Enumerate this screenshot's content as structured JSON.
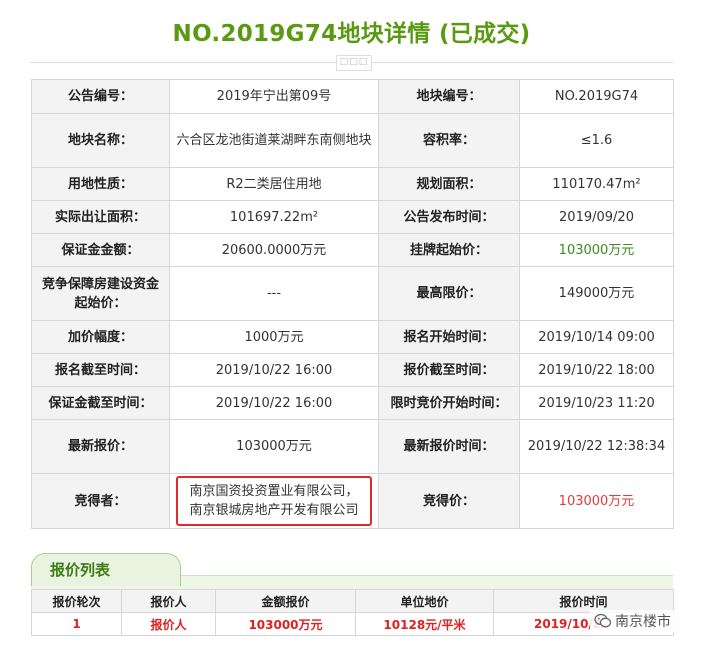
{
  "page": {
    "title": "NO.2019G74地块详情 (已成交)",
    "divider_glyph": "□□□"
  },
  "details": {
    "rows": [
      {
        "k1": "公告编号：",
        "v1": "2019年宁出第09号",
        "k2": "地块编号：",
        "v2": "NO.2019G74"
      },
      {
        "k1": "地块名称：",
        "v1": "六合区龙池街道莱湖畔东南侧地块",
        "k2": "容积率：",
        "v2": "≤1.6"
      },
      {
        "k1": "用地性质：",
        "v1": "R2二类居住用地",
        "k2": "规划面积：",
        "v2": "110170.47m²"
      },
      {
        "k1": "实际出让面积：",
        "v1": "101697.22m²",
        "k2": "公告发布时间：",
        "v2": "2019/09/20"
      },
      {
        "k1": "保证金金额：",
        "v1": "20600.0000万元",
        "k2": "挂牌起始价：",
        "v2": "103000万元"
      },
      {
        "k1": "竞争保障房建设资金起始价：",
        "v1": "---",
        "k2": "最高限价：",
        "v2": "149000万元"
      },
      {
        "k1": "加价幅度：",
        "v1": "1000万元",
        "k2": "报名开始时间：",
        "v2": "2019/10/14 09:00"
      },
      {
        "k1": "报名截至时间：",
        "v1": "2019/10/22 16:00",
        "k2": "报价截至时间：",
        "v2": "2019/10/22 18:00"
      },
      {
        "k1": "保证金截至时间：",
        "v1": "2019/10/22 16:00",
        "k2": "限时竞价开始时间：",
        "v2": "2019/10/23 11:20"
      },
      {
        "k1": "最新报价：",
        "v1": "103000万元",
        "k2": "最新报价时间：",
        "v2": "2019/10/22 12:38:34"
      },
      {
        "k1": "竞得者：",
        "v1": "南京国资投资置业有限公司，南京银城房地产开发有限公司",
        "k2": "竞得价：",
        "v2": "103000万元"
      }
    ],
    "highlight_color": "#e12a2a",
    "green": "#3b8b1f",
    "red": "#e13a3a"
  },
  "price_list": {
    "tab_label": "报价列表",
    "headers": [
      "报价轮次",
      "报价人",
      "金额报价",
      "单位地价",
      "报价时间"
    ],
    "rows": [
      {
        "round": "1",
        "bidder": "报价人",
        "amount": "103000万元",
        "unit_price": "10128元/平米",
        "time": "2019/10/22"
      }
    ]
  },
  "watermark": {
    "text": "南京楼市",
    "icon": "wechat-logo"
  }
}
